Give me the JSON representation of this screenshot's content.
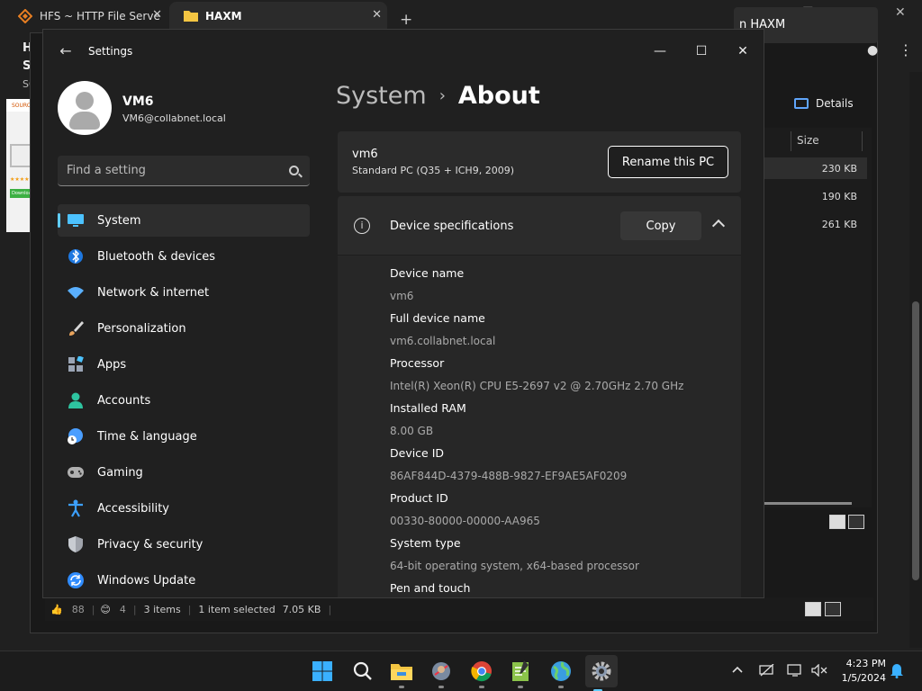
{
  "browser": {
    "tabs": [
      {
        "title": "HFS ~ HTTP File Serve",
        "close": "✕"
      },
      {
        "title": "HAXM",
        "close": "✕"
      }
    ],
    "new_tab": "+",
    "page_heading_1": "HFS",
    "page_heading_2": "Sou",
    "page_heading_3": "SOU",
    "thumb_source": "SOURCE",
    "thumb_download": "Download",
    "thumb_stars": "★★★★★"
  },
  "explorer": {
    "header_text": "n HAXM",
    "details_label": "Details",
    "size_column": "Size",
    "sizes": [
      "230 KB",
      "190 KB",
      "261 KB"
    ],
    "status": {
      "likes": "88",
      "reactions": "4",
      "items": "3 items",
      "selected": "1 item selected",
      "selected_size": "7.05 KB"
    }
  },
  "settings": {
    "window_title": "Settings",
    "user": {
      "name": "VM6",
      "email": "VM6@collabnet.local"
    },
    "search": {
      "placeholder": "Find a setting"
    },
    "nav": [
      {
        "label": "System",
        "icon": "monitor-icon",
        "color": "#4cc2ff"
      },
      {
        "label": "Bluetooth & devices",
        "icon": "bluetooth-icon",
        "color": "#1e90ff"
      },
      {
        "label": "Network & internet",
        "icon": "wifi-icon",
        "color": "#5ab0ff"
      },
      {
        "label": "Personalization",
        "icon": "brush-icon",
        "color": "#e8a35c"
      },
      {
        "label": "Apps",
        "icon": "apps-icon",
        "color": "#9aa4b4"
      },
      {
        "label": "Accounts",
        "icon": "person-icon",
        "color": "#2ec4a0"
      },
      {
        "label": "Time & language",
        "icon": "globe-clock-icon",
        "color": "#4a9eff"
      },
      {
        "label": "Gaming",
        "icon": "gamepad-icon",
        "color": "#aaaaaa"
      },
      {
        "label": "Accessibility",
        "icon": "accessibility-icon",
        "color": "#3ca0ff"
      },
      {
        "label": "Privacy & security",
        "icon": "shield-icon",
        "color": "#9aa0aa"
      },
      {
        "label": "Windows Update",
        "icon": "update-icon",
        "color": "#2f8cff"
      }
    ],
    "breadcrumb": {
      "parent": "System",
      "separator": "›",
      "current": "About"
    },
    "pc": {
      "name": "vm6",
      "model": "Standard PC (Q35 + ICH9, 2009)",
      "rename_label": "Rename this PC"
    },
    "specs": {
      "title": "Device specifications",
      "copy_label": "Copy",
      "items": [
        {
          "label": "Device name",
          "value": "vm6"
        },
        {
          "label": "Full device name",
          "value": "vm6.collabnet.local"
        },
        {
          "label": "Processor",
          "value": "Intel(R) Xeon(R) CPU E5-2697 v2 @ 2.70GHz   2.70 GHz"
        },
        {
          "label": "Installed RAM",
          "value": "8.00 GB"
        },
        {
          "label": "Device ID",
          "value": "86AF844D-4379-488B-9827-EF9AE5AF0209"
        },
        {
          "label": "Product ID",
          "value": "00330-80000-00000-AA965"
        },
        {
          "label": "System type",
          "value": "64-bit operating system, x64-based processor"
        },
        {
          "label": "Pen and touch",
          "value": ""
        }
      ]
    }
  },
  "taskbar": {
    "clock_time": "4:23 PM",
    "clock_date": "1/5/2024",
    "apps": [
      "start-icon",
      "search-icon",
      "file-explorer-icon",
      "app-icon",
      "chrome-icon",
      "notepad-icon",
      "globe-icon",
      "settings-gear-icon"
    ]
  }
}
